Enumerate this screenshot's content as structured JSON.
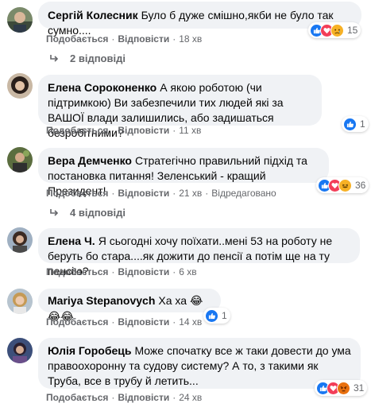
{
  "actions": {
    "like": "Подобається",
    "reply": "Відповісти",
    "edited": "Відредаговано",
    "dot": "·"
  },
  "comments": [
    {
      "author": "Сергій Колесник",
      "text": "Було б дуже смішно,якби не було так сумно....",
      "time": "18 хв",
      "reactions": [
        "like-icon",
        "love-icon",
        "sad-icon"
      ],
      "reaction_count": "15",
      "replies": "2 відповіді"
    },
    {
      "author": "Елена Сороконенко",
      "text": "А якою роботою (чи підтримкою) Ви забезпечили тих людей які за ВАШОЇ влади залишились, або задишаться безробітними?",
      "time": "11 хв",
      "reactions": [
        "like-icon"
      ],
      "reaction_count": "1"
    },
    {
      "author": "Вера Демченко",
      "text": "Стратегічно правильний підхід та постановка питання! Зеленський - кращий Президент!",
      "time": "21 хв",
      "edited": true,
      "reactions": [
        "like-icon",
        "love-icon",
        "haha-icon"
      ],
      "reaction_count": "36",
      "replies": "4 відповіді"
    },
    {
      "author": "Елена Ч.",
      "text": "Я сьогодні хочу поїхати..мені 53 на роботу не беруть бо стара....як дожити до пенсії а потім ще на ту пенсію?",
      "time": "6 хв"
    },
    {
      "author": "Mariya Stepanovych",
      "text": "Ха ха",
      "emoji": "😂😂😂",
      "time": "14 хв",
      "reactions": [
        "like-icon"
      ],
      "reaction_count": "1"
    },
    {
      "author": "Юлія Горобець",
      "text": "Може спочатку все ж таки довести до ума правоохоронну та судову систему? А то, з такими як Труба, все в трубу й летить...",
      "time": "24 хв",
      "reactions": [
        "like-icon",
        "love-icon",
        "angry-icon"
      ],
      "reaction_count": "31"
    }
  ],
  "colors": {
    "like": "#1877f2",
    "love": "#f33e58",
    "haha": "#f7b125",
    "sad": "#f7b125",
    "angry": "#e9710f",
    "bubble": "#f0f2f5",
    "meta": "#65676b"
  }
}
